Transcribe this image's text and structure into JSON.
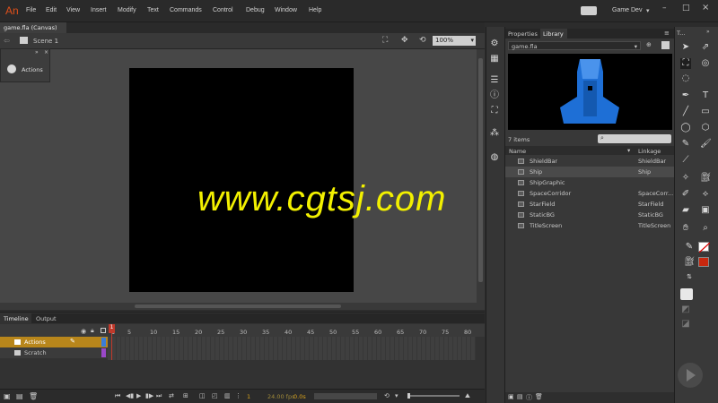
{
  "app": {
    "logo": "An",
    "workspace": "Game Dev"
  },
  "menu": [
    "File",
    "Edit",
    "View",
    "Insert",
    "Modify",
    "Text",
    "Commands",
    "Control",
    "Debug",
    "Window",
    "Help"
  ],
  "document": {
    "tab": "game.fla (Canvas)",
    "scene": "Scene 1",
    "zoom": "100%"
  },
  "actions_panel": {
    "label": "Actions"
  },
  "timeline": {
    "tabs": [
      "Timeline",
      "Output"
    ],
    "layers": [
      "Actions",
      "Scratch"
    ],
    "ticks": [
      "1",
      "5",
      "10",
      "15",
      "20",
      "25",
      "30",
      "35",
      "40",
      "45",
      "50",
      "55",
      "60",
      "65",
      "70",
      "75",
      "80"
    ],
    "frame": "1",
    "fps": "24.00 fps",
    "time": "0.0s"
  },
  "library": {
    "tabs": [
      "Properties",
      "Library"
    ],
    "file": "game.fla",
    "count": "7 items",
    "columns": {
      "name": "Name",
      "linkage": "Linkage"
    },
    "items": [
      {
        "name": "ShieldBar",
        "linkage": "ShieldBar"
      },
      {
        "name": "Ship",
        "linkage": "Ship"
      },
      {
        "name": "ShipGraphic",
        "linkage": ""
      },
      {
        "name": "SpaceCorridor",
        "linkage": "SpaceCorr..."
      },
      {
        "name": "StarField",
        "linkage": "StarField"
      },
      {
        "name": "StaticBG",
        "linkage": "StaticBG"
      },
      {
        "name": "TitleScreen",
        "linkage": "TitleScreen"
      }
    ]
  },
  "tools_header": "T...",
  "watermark": "www.cgtsj.com",
  "colors": {
    "accent": "#e0501a",
    "layer_selected": "#b8861b",
    "ship": "#1e6fd6"
  }
}
